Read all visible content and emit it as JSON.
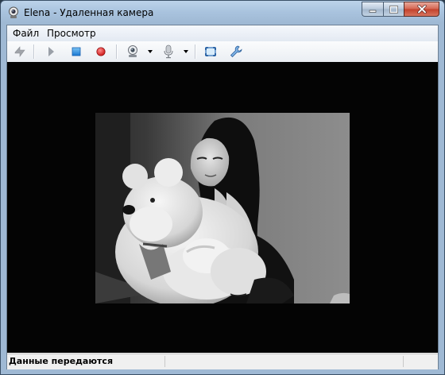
{
  "window": {
    "title": "Elena - Удаленная камера"
  },
  "menu": [
    {
      "label": "Файл"
    },
    {
      "label": "Просмотр"
    }
  ],
  "toolbar": {
    "buttons": [
      "connect-icon",
      "play-icon",
      "stop-icon",
      "record-icon",
      "webcam-icon",
      "microphone-icon",
      "fit-window-icon",
      "settings-wrench-icon"
    ]
  },
  "status": {
    "text": "Данные передаются"
  },
  "colors": {
    "stop": "#2a8be0",
    "record": "#d8232a",
    "video_bg": "#040404"
  }
}
